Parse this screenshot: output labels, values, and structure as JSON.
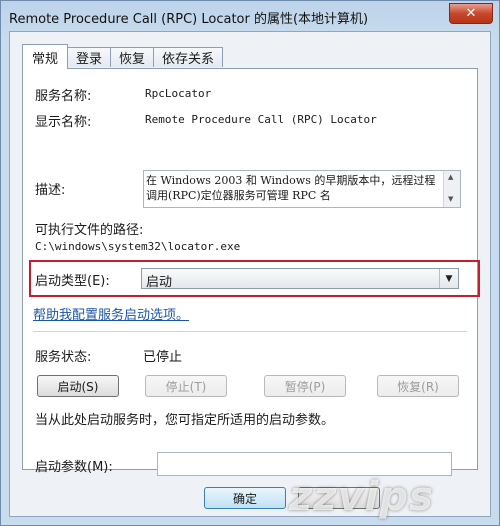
{
  "window": {
    "title": "Remote Procedure Call (RPC) Locator 的属性(本地计算机)",
    "close_glyph": "✕"
  },
  "tabs": [
    {
      "label": "常规",
      "active": true
    },
    {
      "label": "登录",
      "active": false
    },
    {
      "label": "恢复",
      "active": false
    },
    {
      "label": "依存关系",
      "active": false
    }
  ],
  "general": {
    "service_name_label": "服务名称:",
    "service_name": "RpcLocator",
    "display_name_label": "显示名称:",
    "display_name": "Remote Procedure Call (RPC) Locator",
    "description_label": "描述:",
    "description": "在 Windows 2003 和 Windows 的早期版本中，远程过程调用(RPC)定位器服务可管理 RPC 名",
    "exe_path_label": "可执行文件的路径:",
    "exe_path": "C:\\windows\\system32\\locator.exe",
    "startup_type_label": "启动类型(E):",
    "startup_type_value": "启动",
    "help_link": "帮助我配置服务启动选项。",
    "service_status_label": "服务状态:",
    "service_status": "已停止",
    "hint": "当从此处启动服务时，您可指定所适用的启动参数。",
    "start_params_label": "启动参数(M):",
    "start_params_value": ""
  },
  "buttons": {
    "start": "启动(S)",
    "stop": "停止(T)",
    "pause": "暂停(P)",
    "resume": "恢复(R)",
    "ok": "确定",
    "cancel": ""
  },
  "watermark": "zzvips",
  "colors": {
    "highlight": "#c2202f",
    "link": "#1c56a8",
    "close_button": "#c6482c"
  }
}
